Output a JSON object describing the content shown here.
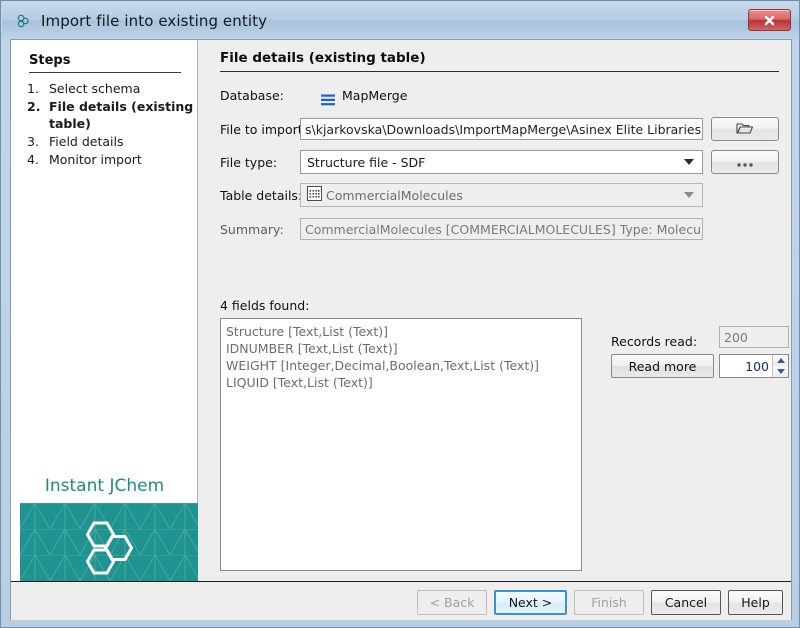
{
  "window": {
    "title": "Import file into existing entity",
    "title_icon": "jchem-hexagons-icon",
    "close_label": "x",
    "accent": "#1f938f",
    "titlebar_color": "#b4cbe2"
  },
  "steps": {
    "heading": "Steps",
    "items": [
      {
        "num": "1.",
        "label": "Select schema",
        "active": false
      },
      {
        "num": "2.",
        "label": "File details (existing table)",
        "active": true
      },
      {
        "num": "3.",
        "label": "Field details",
        "active": false
      },
      {
        "num": "4.",
        "label": "Monitor import",
        "active": false
      }
    ]
  },
  "brand": {
    "name": "Instant JChem",
    "logo_icon": "jchem-hexagons-logo"
  },
  "main": {
    "title": "File details (existing table)",
    "labels": {
      "database": "Database:",
      "file_to_import": "File to import:",
      "file_type": "File type:",
      "table_details": "Table details:",
      "summary": "Summary:",
      "fields_found": "4 fields found:",
      "records_read": "Records read:"
    },
    "database": {
      "icon": "database-lines-icon",
      "value": "MapMerge"
    },
    "file_to_import": {
      "value": "s\\kjarkovska\\Downloads\\ImportMapMerge\\Asinex Elite Libraries.sdf",
      "browse_icon": "folder-open-icon"
    },
    "file_type": {
      "value": "Structure file - SDF",
      "options": [
        "Structure file - SDF"
      ],
      "more_button_label": "..."
    },
    "table_details": {
      "icon": "table-grid-icon",
      "value": "CommercialMolecules",
      "options": [
        "CommercialMolecules"
      ]
    },
    "summary": {
      "value": "CommercialMolecules [COMMERCIALMOLECULES] Type: Molecules"
    },
    "fields": [
      "Structure [Text,List (Text)]",
      "IDNUMBER [Text,List (Text)]",
      "WEIGHT [Integer,Decimal,Boolean,Text,List (Text)]",
      "LIQUID [Text,List (Text)]"
    ],
    "records_read_value": "200",
    "read_more_label": "Read more",
    "read_count_value": "100"
  },
  "footer": {
    "back": "< Back",
    "next": "Next >",
    "finish": "Finish",
    "cancel": "Cancel",
    "help": "Help"
  }
}
